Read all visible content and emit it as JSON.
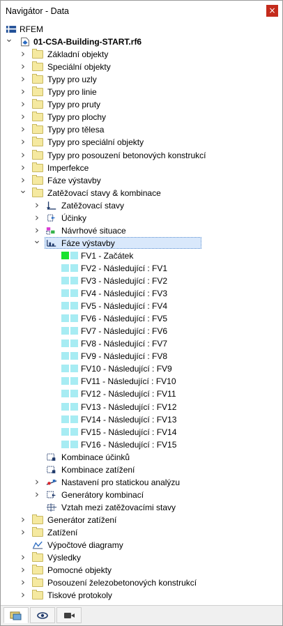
{
  "window": {
    "title": "Navigátor - Data",
    "close_label": "×"
  },
  "tree": {
    "root": "RFEM",
    "project": "01-CSA-Building-START.rf6",
    "folders_top": [
      "Základní objekty",
      "Speciální objekty",
      "Typy pro uzly",
      "Typy pro linie",
      "Typy pro pruty",
      "Typy pro plochy",
      "Typy pro tělesa",
      "Typy pro speciální objekty",
      "Typy pro posouzení betonových konstrukcí",
      "Imperfekce",
      "Fáze výstavby",
      "Zatěžovací stavy & kombinace"
    ],
    "lc_children": {
      "load_cases": "Zatěžovací stavy",
      "actions": "Účinky",
      "design_situations": "Návrhové situace",
      "construction_stages": "Fáze výstavby"
    },
    "stages": [
      "FV1 - Začátek",
      "FV2 - Následující : FV1",
      "FV3 - Následující : FV2",
      "FV4 - Následující : FV3",
      "FV5 - Následující : FV4",
      "FV6 - Následující : FV5",
      "FV7 - Následující : FV6",
      "FV8 - Následující : FV7",
      "FV9 - Následující : FV8",
      "FV10 - Následující : FV9",
      "FV11 - Následující : FV10",
      "FV12 - Následující : FV11",
      "FV13 - Následující : FV12",
      "FV14 - Následující : FV13",
      "FV15 - Následující : FV14",
      "FV16 - Následující : FV15"
    ],
    "lc_after": {
      "action_combinations": "Kombinace účinků",
      "load_combinations": "Kombinace zatížení",
      "static_analysis_settings": "Nastavení pro statickou analýzu",
      "combination_wizards": "Generátory kombinací",
      "relationships": "Vztah mezi zatěžovacími stavy"
    },
    "folders_bottom": [
      {
        "label": "Generátor zatížení",
        "kind": "folder"
      },
      {
        "label": "Zatížení",
        "kind": "folder"
      },
      {
        "label": "Výpočtové diagramy",
        "kind": "diagram"
      },
      {
        "label": "Výsledky",
        "kind": "folder"
      },
      {
        "label": "Pomocné objekty",
        "kind": "folder"
      },
      {
        "label": "Posouzení železobetonových konstrukcí",
        "kind": "folder"
      },
      {
        "label": "Tiskové protokoly",
        "kind": "folder"
      }
    ]
  },
  "bottom_tabs": [
    {
      "icon": "data-navigator-icon",
      "active": true
    },
    {
      "icon": "eye-icon",
      "active": false
    },
    {
      "icon": "video-camera-icon",
      "active": false
    }
  ],
  "colors": {
    "stage_first": "#19e32e",
    "stage_other": "#a7ecf3",
    "selection": "#d9e8fb"
  }
}
